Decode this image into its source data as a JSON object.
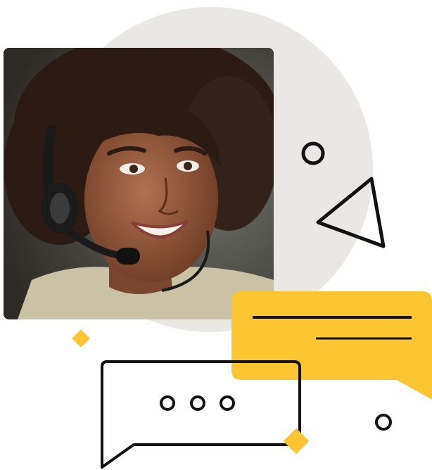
{
  "photo": {
    "icon": "support-agent-photo"
  },
  "colors": {
    "background": "#ffffff",
    "circle": "#e9e8e5",
    "accent_yellow": "#fcc632",
    "outline": "#111111"
  },
  "icons": {
    "small_circle": "ring-icon",
    "triangle": "triangle-icon",
    "diamond": "diamond-icon",
    "yellow_bubble": "chat-bubble-icon",
    "outline_bubble": "typing-bubble-icon"
  }
}
